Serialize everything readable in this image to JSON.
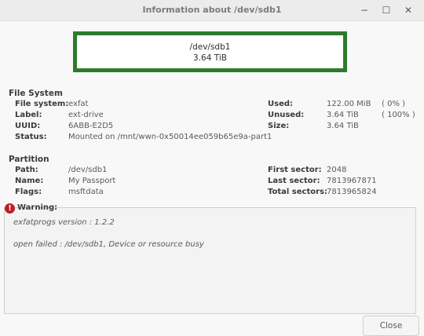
{
  "window": {
    "title": "Information about /dev/sdb1",
    "controls": {
      "minimize": "−",
      "maximize": "☐",
      "close": "✕"
    }
  },
  "partition_graphic": {
    "name": "/dev/sdb1",
    "size": "3.64 TiB",
    "border_color": "#2d7a2d"
  },
  "file_system": {
    "heading": "File System",
    "fields": [
      {
        "label": "File system:",
        "value": "exfat"
      },
      {
        "label": "Label:",
        "value": "ext-drive"
      },
      {
        "label": "UUID:",
        "value": "6ABB-E2D5"
      },
      {
        "label": "Status:",
        "value": "Mounted on /mnt/wwn-0x50014ee059b65e9a-part1"
      }
    ],
    "usage": [
      {
        "label": "Used:",
        "value": "122.00 MiB",
        "percent": "( 0% )"
      },
      {
        "label": "Unused:",
        "value": "3.64 TiB",
        "percent": "( 100% )"
      },
      {
        "label": "Size:",
        "value": "3.64 TiB",
        "percent": ""
      }
    ]
  },
  "partition": {
    "heading": "Partition",
    "fields": [
      {
        "label": "Path:",
        "value": "/dev/sdb1"
      },
      {
        "label": "Name:",
        "value": "My Passport"
      },
      {
        "label": "Flags:",
        "value": "msftdata"
      }
    ],
    "sectors": [
      {
        "label": "First sector:",
        "value": "2048"
      },
      {
        "label": "Last sector:",
        "value": "7813967871"
      },
      {
        "label": "Total sectors:",
        "value": "7813965824"
      }
    ]
  },
  "warning": {
    "icon": "error-icon",
    "label": "Warning:",
    "lines": [
      "exfatprogs version : 1.2.2",
      "open failed : /dev/sdb1, Device or resource busy"
    ]
  },
  "buttons": {
    "close": "Close"
  }
}
